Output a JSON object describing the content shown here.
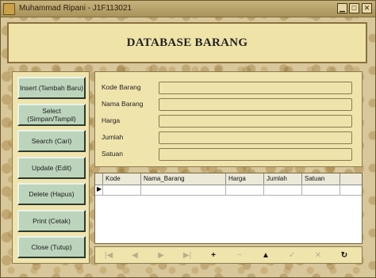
{
  "window": {
    "title": "Muhammad Ripani - J1F113021",
    "controls": {
      "minimize": "▁",
      "maximize": "□",
      "close": "✕"
    }
  },
  "header": {
    "title": "DATABASE BARANG"
  },
  "buttons": [
    {
      "label": "Insert (Tambah Baru)"
    },
    {
      "label": "Select (Simpan/Tampil)"
    },
    {
      "label": "Search (Cari)"
    },
    {
      "label": "Update (Edit)"
    },
    {
      "label": "Delete (Hapus)"
    },
    {
      "label": "Print (Cetak)"
    },
    {
      "label": "Close (Tutup)"
    }
  ],
  "form": {
    "fields": [
      {
        "label": "Kode Barang",
        "value": ""
      },
      {
        "label": "Nama Barang",
        "value": ""
      },
      {
        "label": "Harga",
        "value": ""
      },
      {
        "label": "Jumlah",
        "value": ""
      },
      {
        "label": "Satuan",
        "value": ""
      }
    ]
  },
  "grid": {
    "columns": [
      "Kode",
      "Nama_Barang",
      "Harga",
      "Jumlah",
      "Satuan"
    ],
    "row_indicator": "▶"
  },
  "navigator": {
    "buttons": [
      {
        "icon": "first-icon",
        "glyph": "|◀",
        "enabled": false
      },
      {
        "icon": "prior-icon",
        "glyph": "◀",
        "enabled": false
      },
      {
        "icon": "next-icon",
        "glyph": "▶",
        "enabled": false
      },
      {
        "icon": "last-icon",
        "glyph": "▶|",
        "enabled": false
      },
      {
        "icon": "insert-icon",
        "glyph": "+",
        "enabled": true
      },
      {
        "icon": "delete-icon",
        "glyph": "−",
        "enabled": false
      },
      {
        "icon": "edit-icon",
        "glyph": "▲",
        "enabled": true
      },
      {
        "icon": "post-icon",
        "glyph": "✓",
        "enabled": false
      },
      {
        "icon": "cancel-icon",
        "glyph": "✕",
        "enabled": false
      },
      {
        "icon": "refresh-icon",
        "glyph": "↻",
        "enabled": true
      }
    ]
  }
}
